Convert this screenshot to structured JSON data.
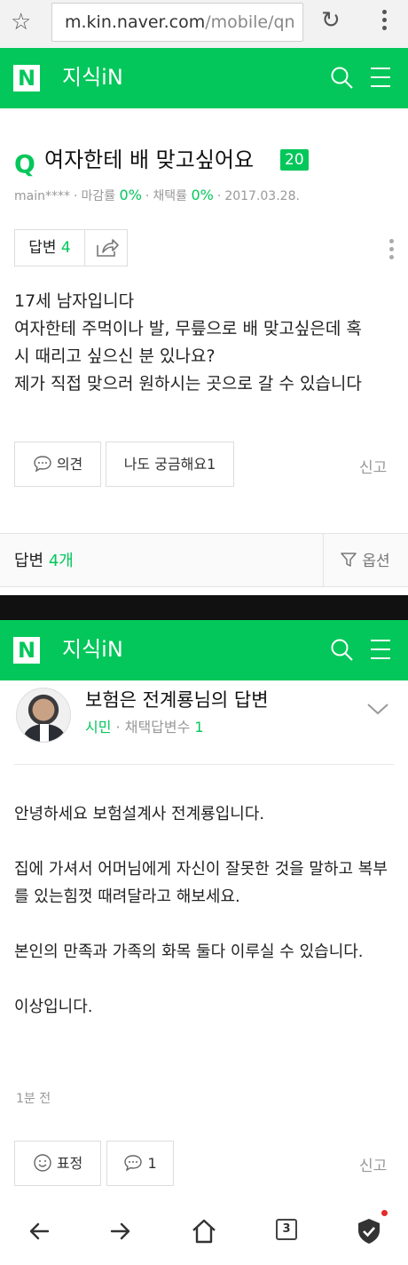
{
  "browser": {
    "url_main": "m.kin.naver.com",
    "url_path": "/mobile/qn"
  },
  "header": {
    "logo": "N",
    "service": "지식iN"
  },
  "question": {
    "q_mark": "Q",
    "title": "여자한테 배 맞고싶어요",
    "points": "20",
    "author": "main****",
    "close_rate_label": "마감률",
    "close_rate_value": "0%",
    "adopt_rate_label": "채택률",
    "adopt_rate_value": "0%",
    "date": "2017.03.28.",
    "answer_label": "답변",
    "answer_count": "4",
    "body": [
      "17세 남자입니다",
      "여자한테 주먹이나 발, 무릎으로 배 맞고싶은데 혹\n시 때리고 싶으신 분 있나요?",
      "제가 직접 맞으러 원하시는 곳으로 갈 수 있습니다"
    ],
    "opinion_label": "의견",
    "curious_label": "나도 궁금해요1",
    "report_label": "신고"
  },
  "answers_bar": {
    "label": "답변",
    "count": "4개",
    "filter_label": "옵션"
  },
  "answer": {
    "author_title": "보험은 전계룡님의 답변",
    "rank": "시민",
    "adopt_label": "채택답변수",
    "adopt_count": "1",
    "body": [
      "안녕하세요 보험설계사 전계룡입니다.",
      "집에 가셔서 어머님에게 자신이 잘못한 것을 말하고 복부를 있는힘껏 때려달라고 해보세요.",
      "본인의 만족과 가족의 화목 둘다 이루실 수 있습니다.",
      "이상입니다."
    ],
    "time": "1분 전",
    "reaction_label": "표정",
    "comment_count": "1",
    "report_label": "신고"
  },
  "bottom_nav": {
    "tab_count": "3"
  },
  "colors": {
    "brand_green": "#03c75a",
    "gray_text": "#999999"
  }
}
